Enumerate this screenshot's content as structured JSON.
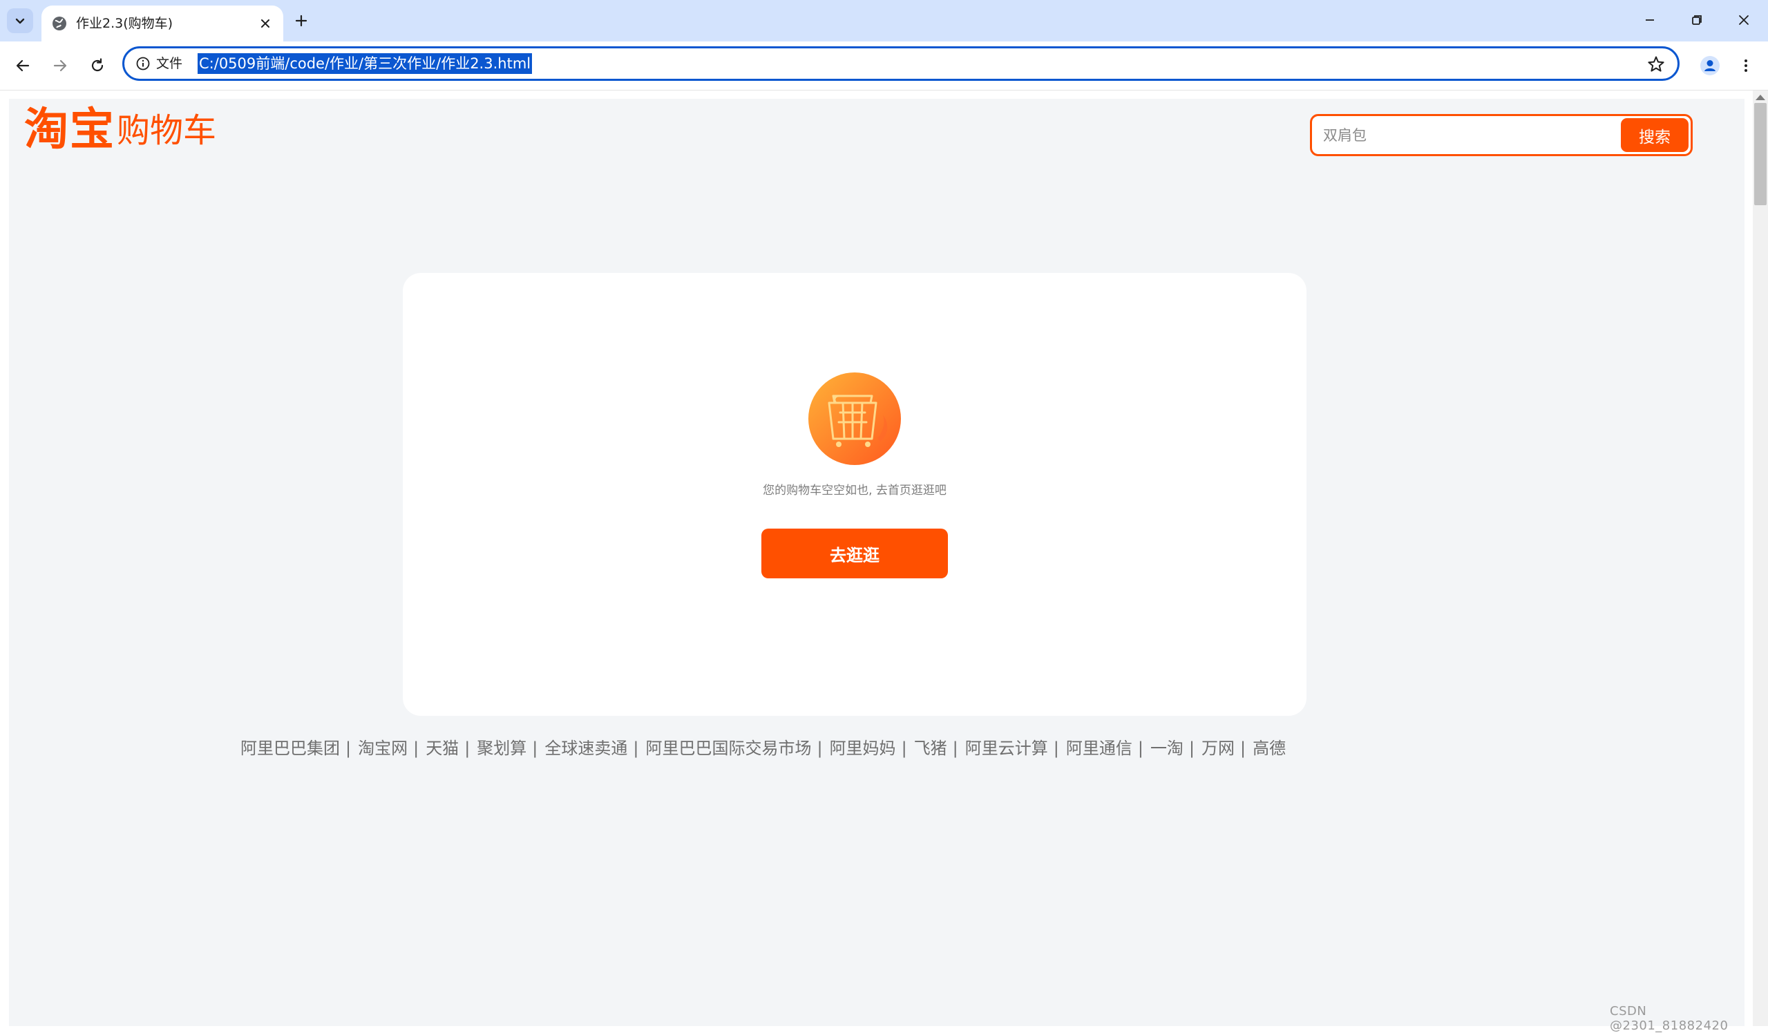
{
  "browser": {
    "tab_title": "作业2.3(购物车)",
    "omnibox": {
      "scheme_label": "文件",
      "url": "C:/0509前端/code/作业/第三次作业/作业2.3.html"
    }
  },
  "page": {
    "logo": {
      "main": "淘宝",
      "sub": "购物车"
    },
    "search": {
      "placeholder": "双肩包",
      "button_label": "搜索"
    },
    "empty_cart": {
      "message": "您的购物车空空如也, 去首页逛逛吧",
      "button_label": "去逛逛"
    },
    "footer_links": [
      "阿里巴巴集团",
      "淘宝网",
      "天猫",
      "聚划算",
      "全球速卖通",
      "阿里巴巴国际交易市场",
      "阿里妈妈",
      "飞猪",
      "阿里云计算",
      "阿里通信",
      "一淘",
      "万网",
      "高德"
    ],
    "footer_separator": "|"
  },
  "watermark": "CSDN @2301_81882420",
  "colors": {
    "brand": "#ff5000",
    "page_bg": "#f3f5f7",
    "chrome_bg": "#d3e3fd",
    "accent": "#0b57d0"
  }
}
